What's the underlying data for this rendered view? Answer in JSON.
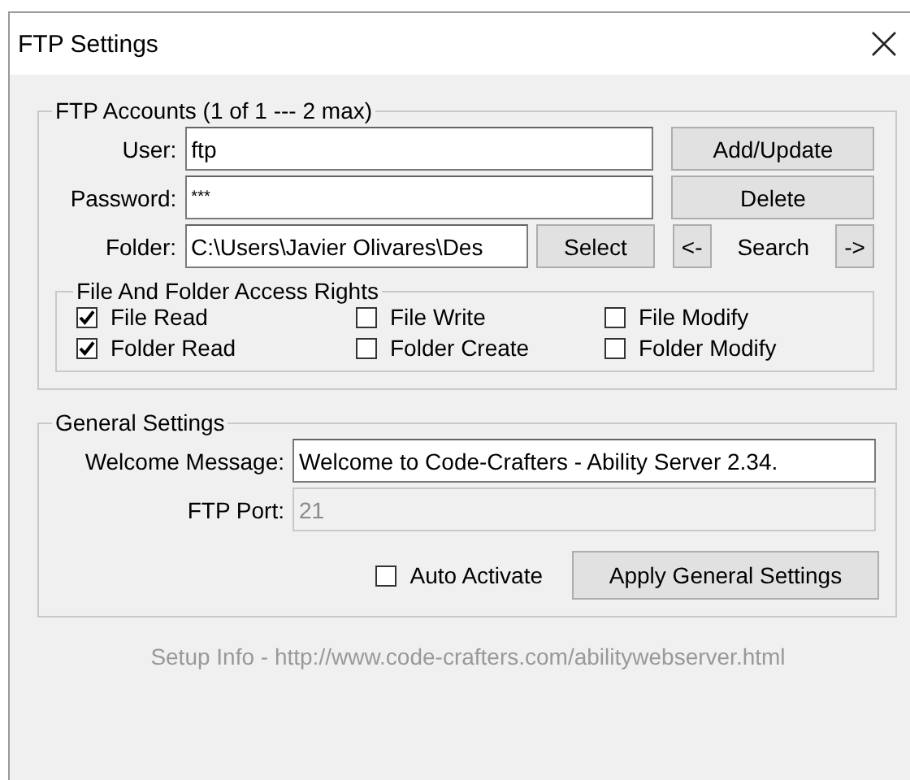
{
  "window": {
    "title": "FTP Settings"
  },
  "accounts": {
    "legend": "FTP Accounts (1 of 1 --- 2 max)",
    "user": {
      "label": "User:",
      "value": "ftp"
    },
    "password": {
      "label": "Password:",
      "value": "***"
    },
    "folder": {
      "label": "Folder:",
      "value": "C:\\Users\\Javier Olivares\\Des"
    },
    "select_button": "Select",
    "add_button": "Add/Update",
    "delete_button": "Delete",
    "prev_button": "<-",
    "search_label": "Search",
    "next_button": "->"
  },
  "rights": {
    "legend": "File And Folder Access Rights",
    "items": [
      {
        "label": "File Read",
        "checked": true
      },
      {
        "label": "File Write",
        "checked": false
      },
      {
        "label": "File Modify",
        "checked": false
      },
      {
        "label": "Folder Read",
        "checked": true
      },
      {
        "label": "Folder Create",
        "checked": false
      },
      {
        "label": "Folder Modify",
        "checked": false
      }
    ]
  },
  "general": {
    "legend": "General Settings",
    "welcome": {
      "label": "Welcome Message:",
      "value": "Welcome to Code-Crafters - Ability Server 2.34.",
      "disabled": false
    },
    "port": {
      "label": "FTP Port:",
      "value": "21",
      "disabled": true
    },
    "auto_activate": {
      "label": "Auto Activate",
      "checked": false
    },
    "apply_button": "Apply General Settings"
  },
  "footer": "Setup Info - http://www.code-crafters.com/abilitywebserver.html"
}
